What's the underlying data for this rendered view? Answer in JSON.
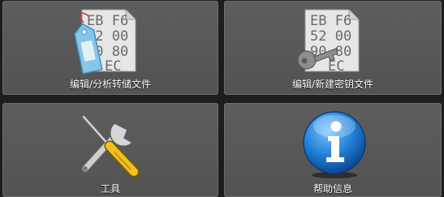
{
  "tiles": [
    {
      "label": "编辑/分析转储文件",
      "icon": "dump-file-tag-icon"
    },
    {
      "label": "编辑/新建密钥文件",
      "icon": "key-file-icon"
    },
    {
      "label": "工具",
      "icon": "tools-icon"
    },
    {
      "label": "帮助信息",
      "icon": "info-icon"
    }
  ],
  "hex_lines": [
    "EB F6",
    "52 00",
    "90 80",
    "EC"
  ],
  "colors": {
    "tile": "#575757",
    "tile_border": "#6e6e6e",
    "background": "#1d1d1d",
    "label": "#ffffff",
    "tag": "#7fc3e6",
    "info": "#1f7fd6"
  }
}
